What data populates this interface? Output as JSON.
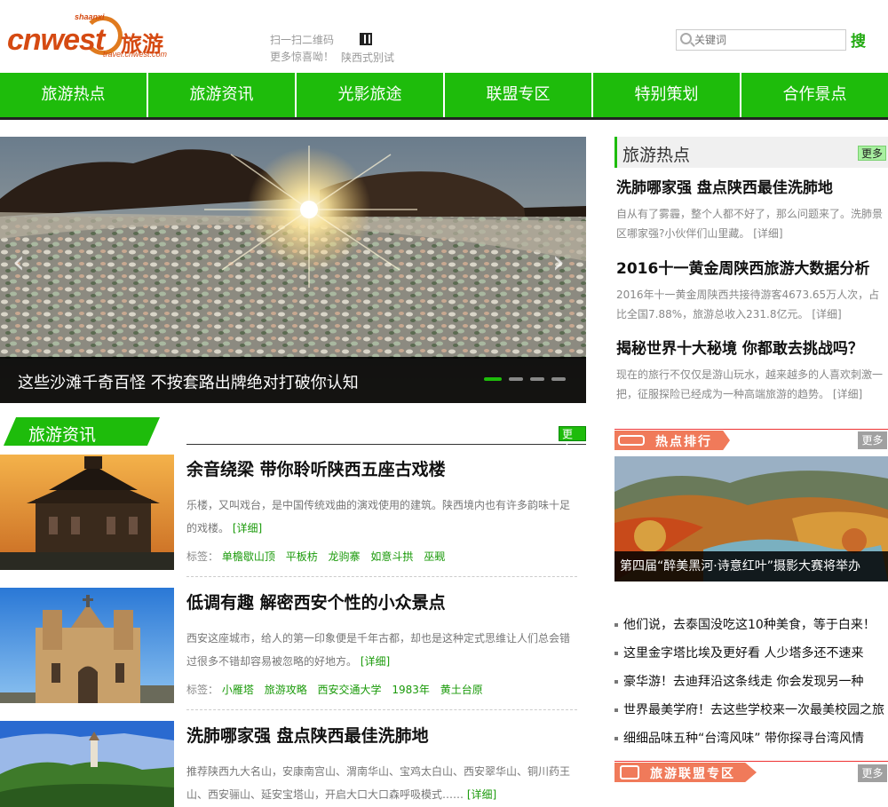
{
  "header": {
    "logo_brand": "cnwest",
    "logo_region": "shaanxi",
    "logo_title": "旅游",
    "logo_domain": "travel.cnwest.com",
    "qr_line1": "扫一扫二维码",
    "qr_line2": "更多惊喜呦！",
    "qr_sub": "陕西式别试",
    "search_placeholder": "关键词",
    "search_button": "搜"
  },
  "nav": {
    "items": [
      "旅游热点",
      "旅游资讯",
      "光影旅途",
      "联盟专区",
      "特别策划",
      "合作景点"
    ]
  },
  "slider": {
    "caption": "这些沙滩千奇百怪 不按套路出牌绝对打破你认知",
    "prev": "‹",
    "next": "›",
    "slide_count": 4,
    "active_index": 0
  },
  "news_section": {
    "title": "旅游资讯",
    "more": "更多",
    "articles": [
      {
        "title": "余音绕梁 带你聆听陕西五座古戏楼",
        "desc": "乐楼，又叫戏台，是中国传统戏曲的演戏使用的建筑。陕西境内也有许多韵味十足的戏楼。",
        "detail": "[详细]",
        "tags_label": "标签：",
        "tags": [
          "单檐歇山顶",
          "平板枋",
          "龙驹寨",
          "如意斗拱",
          "巫觋"
        ]
      },
      {
        "title": "低调有趣 解密西安个性的小众景点",
        "desc": "西安这座城市，给人的第一印象便是千年古都，却也是这种定式思维让人们总会错过很多不错却容易被忽略的好地方。",
        "detail": "[详细]",
        "tags_label": "标签：",
        "tags": [
          "小雁塔",
          "旅游攻略",
          "西安交通大学",
          "1983年",
          "黄土台原"
        ]
      },
      {
        "title": "洗肺哪家强 盘点陕西最佳洗肺地",
        "desc": "推荐陕西九大名山，安康南宫山、渭南华山、宝鸡太白山、西安翠华山、铜川药王山、西安骊山、延安宝塔山，开启大口大口森呼吸模式……",
        "detail": "[详细]"
      }
    ]
  },
  "hot_section": {
    "title": "旅游热点",
    "more": "更多",
    "items": [
      {
        "title": "洗肺哪家强 盘点陕西最佳洗肺地",
        "desc": "自从有了雾霾，整个人都不好了，那么问题来了。洗肺景区哪家强?小伙伴们山里藏。",
        "detail": "[详细]"
      },
      {
        "title": "2016十一黄金周陕西旅游大数据分析",
        "desc": "2016年十一黄金周陕西共接待游客4673.65万人次，占比全国7.88%，旅游总收入231.8亿元。",
        "detail": "[详细]"
      },
      {
        "title": "揭秘世界十大秘境 你都敢去挑战吗？",
        "desc": "现在的旅行不仅仅是游山玩水，越来越多的人喜欢刺激一把，征服探险已经成为一种高端旅游的趋势。",
        "detail": "[详细]"
      }
    ]
  },
  "rank_section": {
    "title": "热点排行",
    "more": "更多",
    "feature_caption": "第四届“醉美黑河·诗意红叶”摄影大赛将举办",
    "list": [
      "他们说，去泰国没吃这10种美食，等于白来！",
      "这里金字塔比埃及更好看 人少塔多还不速来",
      "豪华游！去迪拜沿这条线走 你会发现另一种",
      "世界最美学府！去这些学校来一次最美校园之旅",
      "细细品味五种“台湾风味” 带你探寻台湾风情"
    ]
  },
  "union_section": {
    "title": "旅游联盟专区",
    "more": "更多"
  },
  "colors": {
    "brand_green": "#1ebc0b",
    "logo_orange": "#d54a12",
    "rank_red": "#f07a5a"
  }
}
